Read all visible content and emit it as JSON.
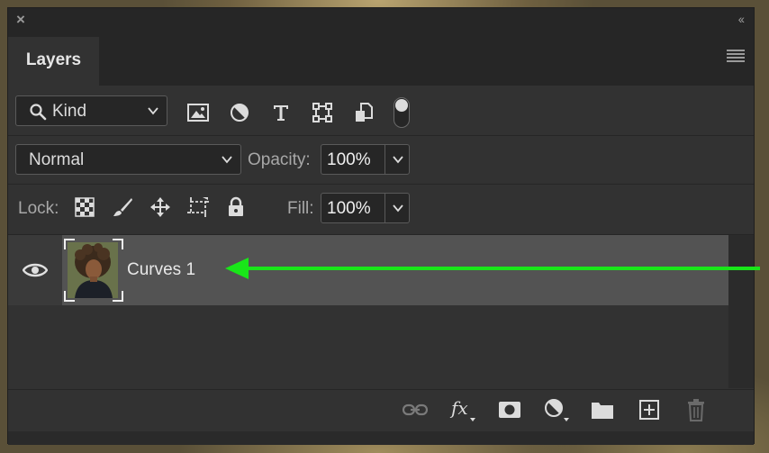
{
  "panel": {
    "tab_label": "Layers",
    "close_glyph": "×",
    "collapse_glyph": "‹‹"
  },
  "filter": {
    "kind_label": "Kind",
    "icons": [
      "search-icon",
      "image-filter-icon",
      "adjustment-filter-icon",
      "type-filter-icon",
      "shape-filter-icon",
      "smart-object-filter-icon"
    ],
    "toggle_on": true
  },
  "blend": {
    "mode": "Normal",
    "opacity_label": "Opacity:",
    "opacity_value": "100%"
  },
  "lock": {
    "label": "Lock:",
    "icons": [
      "lock-transparent-pixels-icon",
      "lock-image-pixels-icon",
      "lock-position-icon",
      "lock-artboard-icon",
      "lock-all-icon"
    ],
    "fill_label": "Fill:",
    "fill_value": "100%"
  },
  "layers": [
    {
      "name": "Curves 1",
      "visible": true,
      "selected": true
    }
  ],
  "footer_icons": [
    "link-layers-icon",
    "fx-icon",
    "add-mask-icon",
    "new-adjustment-layer-icon",
    "new-group-icon",
    "new-layer-icon",
    "delete-layer-icon"
  ],
  "colors": {
    "panel_bg": "#323232",
    "selected_row": "#535353",
    "arrow": "#19e619"
  }
}
